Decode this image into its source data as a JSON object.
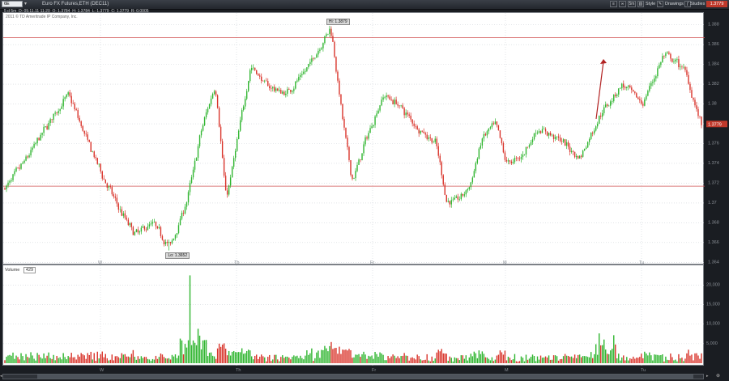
{
  "toolbar": {
    "symbol": "6E",
    "instrument_desc": "Euro FX Futures,ETH (DEC11)",
    "style_label": "Style",
    "drawings_label": "Drawings",
    "studies_label": "Studies",
    "aggregation_label": "5m",
    "current_price": "1.3779"
  },
  "ohlc_bar": {
    "period": "5 d 5m",
    "date": "D: 09.11.11 11:20",
    "open": "O: 1.3784",
    "high": "H: 1.3784",
    "low": "L: 1.3779",
    "close": "C: 1.3779",
    "range": "R: 0.0005"
  },
  "copyright": "2011 © TD Ameritrade IP Company, Inc.",
  "volume": {
    "label": "Volume",
    "value": "429"
  },
  "chart_data": {
    "type": "candlestick",
    "y_axis_ticks": [
      "1.388",
      "1.386",
      "1.384",
      "1.382",
      "1.38",
      "1.378",
      "1.376",
      "1.374",
      "1.372",
      "1.37",
      "1.368",
      "1.366",
      "1.364"
    ],
    "ylim": [
      1.3637,
      1.3892
    ],
    "x_axis_ticks": [
      "W",
      "Th",
      "Fr",
      "M",
      "Tu"
    ],
    "volume_axis_ticks": [
      "20,000",
      "15,000",
      "10,000",
      "5,000"
    ],
    "volume_max": 23000,
    "high_annotation": "Hi: 1.3879",
    "low_annotation": "Lo: 1.3652",
    "high_value": 1.3879,
    "low_value": 1.3652,
    "horizontal_lines": [
      1.3867,
      1.3717
    ],
    "last_price": 1.3779,
    "colors": {
      "up": "#2fb52f",
      "down": "#d9342b",
      "line": "#d05050"
    },
    "path_waypoints": [
      [
        0,
        1.3715
      ],
      [
        6,
        1.3745
      ],
      [
        13,
        1.3785
      ],
      [
        18,
        1.381
      ],
      [
        23,
        1.3765
      ],
      [
        28,
        1.3725
      ],
      [
        33,
        1.369
      ],
      [
        37,
        1.3668
      ],
      [
        42,
        1.368
      ],
      [
        47,
        1.3655
      ],
      [
        52,
        1.3705
      ],
      [
        56,
        1.3775
      ],
      [
        60,
        1.3822
      ],
      [
        63,
        1.37
      ],
      [
        66,
        1.376
      ],
      [
        70,
        1.384
      ],
      [
        74,
        1.382
      ],
      [
        80,
        1.381
      ],
      [
        86,
        1.3835
      ],
      [
        90,
        1.386
      ],
      [
        93,
        1.3878
      ],
      [
        96,
        1.379
      ],
      [
        99,
        1.372
      ],
      [
        103,
        1.3765
      ],
      [
        108,
        1.381
      ],
      [
        112,
        1.38
      ],
      [
        118,
        1.3775
      ],
      [
        123,
        1.376
      ],
      [
        126,
        1.37
      ],
      [
        130,
        1.3705
      ],
      [
        133,
        1.372
      ],
      [
        136,
        1.3765
      ],
      [
        140,
        1.378
      ],
      [
        143,
        1.374
      ],
      [
        147,
        1.3745
      ],
      [
        152,
        1.3775
      ],
      [
        158,
        1.3765
      ],
      [
        164,
        1.3745
      ],
      [
        170,
        1.379
      ],
      [
        176,
        1.382
      ],
      [
        182,
        1.38
      ],
      [
        188,
        1.385
      ],
      [
        194,
        1.3835
      ],
      [
        199,
        1.3775
      ]
    ]
  }
}
